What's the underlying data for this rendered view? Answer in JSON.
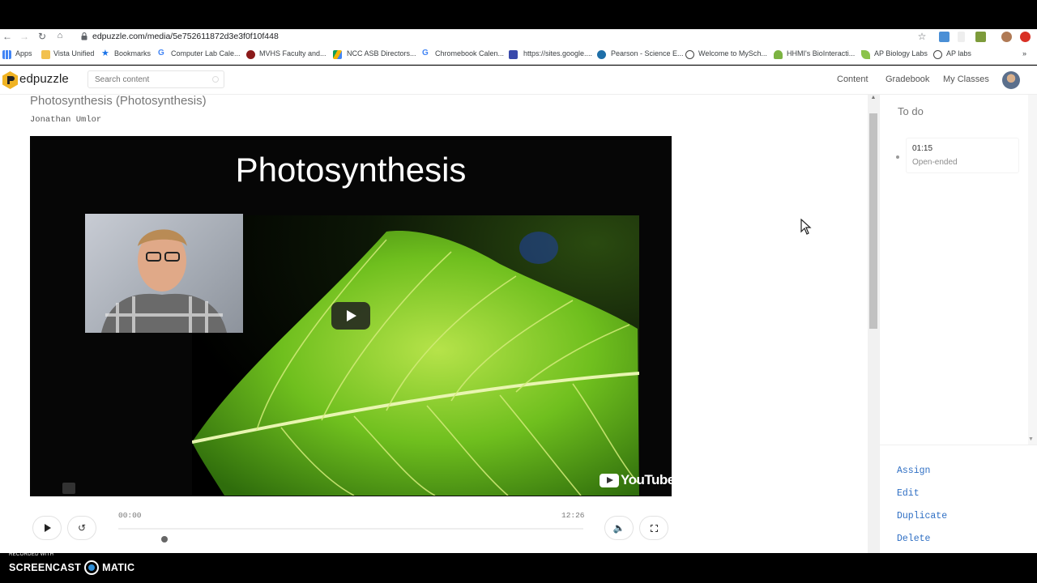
{
  "browser": {
    "url": "edpuzzle.com/media/5e752611872d3e3f0f10f448",
    "bookmarks": [
      {
        "label": "Apps",
        "icon": "apps-grid-icon"
      },
      {
        "label": "Vista Unified",
        "icon": "folder-icon"
      },
      {
        "label": "Bookmarks",
        "icon": "star-icon"
      },
      {
        "label": "Computer Lab Cale...",
        "icon": "google-icon"
      },
      {
        "label": "MVHS Faculty and...",
        "icon": "school-crest-icon"
      },
      {
        "label": "NCC ASB Directors...",
        "icon": "drive-icon"
      },
      {
        "label": "Chromebook Calen...",
        "icon": "google-icon"
      },
      {
        "label": "https://sites.google....",
        "icon": "sites-icon"
      },
      {
        "label": "Pearson - Science E...",
        "icon": "pearson-icon"
      },
      {
        "label": "Welcome to MySch...",
        "icon": "globe-icon"
      },
      {
        "label": "HHMI's BioInteracti...",
        "icon": "hhmi-icon"
      },
      {
        "label": "AP Biology Labs",
        "icon": "leaf-icon"
      },
      {
        "label": "AP labs",
        "icon": "globe-icon"
      }
    ]
  },
  "app": {
    "logo_text": "edpuzzle",
    "search_placeholder": "Search content",
    "nav": {
      "content": "Content",
      "gradebook": "Gradebook",
      "classes": "My Classes"
    }
  },
  "video": {
    "title": "Photosynthesis (Photosynthesis)",
    "creator": "Jonathan Umlor",
    "slide_title": "Photosynthesis",
    "watermark": "YouTube",
    "time_start": "00:00",
    "time_end": "12:26",
    "progress_fraction": 0.1
  },
  "sidebar": {
    "title": "To do",
    "questions": [
      {
        "time": "01:15",
        "type": "Open-ended"
      }
    ],
    "actions": {
      "assign": "Assign",
      "edit": "Edit",
      "duplicate": "Duplicate",
      "delete": "Delete"
    }
  },
  "recorder": {
    "small": "RECORDED WITH",
    "left": "SCREENCAST",
    "right": "MATIC"
  },
  "colors": {
    "accent": "#2f6fc4",
    "logo": "#f0b323",
    "leaf": "#6fbf1e"
  }
}
